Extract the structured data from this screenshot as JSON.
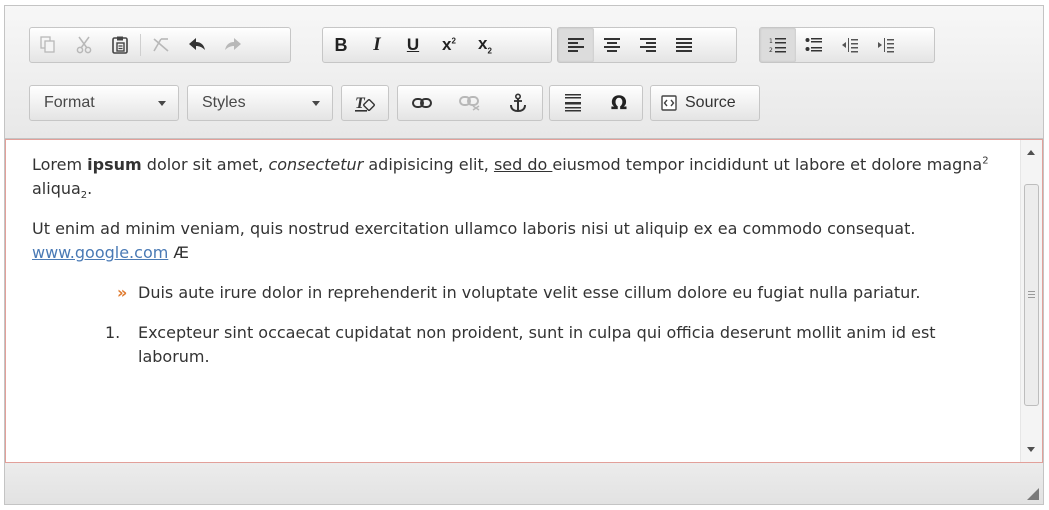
{
  "toolbar": {
    "format_label": "Format",
    "styles_label": "Styles",
    "source_label": "Source",
    "buttons": {
      "copy": "copy-icon",
      "cut": "cut-icon",
      "paste": "paste-icon",
      "remove": "remove-icon",
      "undo": "undo-icon",
      "redo": "redo-icon",
      "bold": "B",
      "italic": "I",
      "underline": "U",
      "superscript": "x",
      "superscript_exp": "2",
      "subscript": "x",
      "subscript_exp": "2",
      "omega": "Ω"
    }
  },
  "content": {
    "p1": {
      "t1": "Lorem ",
      "bold": "ipsum",
      "t2": " dolor sit amet, ",
      "italic": "consectetur",
      "t3": " adipisicing elit, ",
      "underlined": "sed do ",
      "t4": "eiusmod tempor incididunt ut labore et dolore magna",
      "sup": "2",
      "t5": " aliqua",
      "sub": "2",
      "t6": "."
    },
    "p2": {
      "text": "Ut enim ad minim veniam, quis nostrud exercitation ullamco laboris nisi ut aliquip ex ea commodo consequat. ",
      "link": "www.google.com",
      "special": " Æ"
    },
    "bullet_marker": "»",
    "bullet_item": "Duis aute irure dolor in reprehenderit in voluptate velit esse cillum dolore eu fugiat nulla pariatur.",
    "ordered_number": "1.",
    "ordered_item": "Excepteur sint occaecat cupidatat non proident, sunt in culpa qui officia deserunt mollit anim id est laborum."
  },
  "colors": {
    "link": "#4a7ab5",
    "bullet": "#e07b2f",
    "focus_border": "#e2a09a"
  }
}
